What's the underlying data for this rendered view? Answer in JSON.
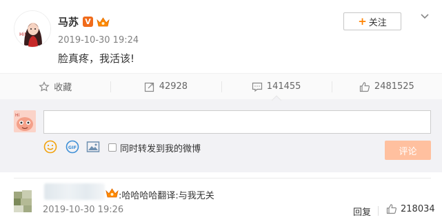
{
  "post": {
    "author": "马苏",
    "verified_badge": "V",
    "time": "2019-10-30 19:24",
    "text": "脸真疼，我活该!",
    "follow_label": "关注",
    "follow_plus": "+"
  },
  "actions": {
    "favorite_label": "收藏",
    "repost_count": "42928",
    "comment_count": "141455",
    "like_count": "2481525"
  },
  "composer": {
    "input_value": "",
    "input_placeholder": "",
    "repost_option_label": "同时转发到我的微博",
    "submit_label": "评论"
  },
  "comment": {
    "text": "哈哈哈哈翻译:与我无关",
    "colon": ":",
    "time": "2019-10-30 19:26",
    "reply_label": "回复",
    "like_count": "218034"
  },
  "colors": {
    "accent_orange": "#ff8200",
    "submit_disabled": "#ffc09f",
    "verified_orange": "#f06b1b",
    "composer_bg": "#f2f2f5"
  }
}
